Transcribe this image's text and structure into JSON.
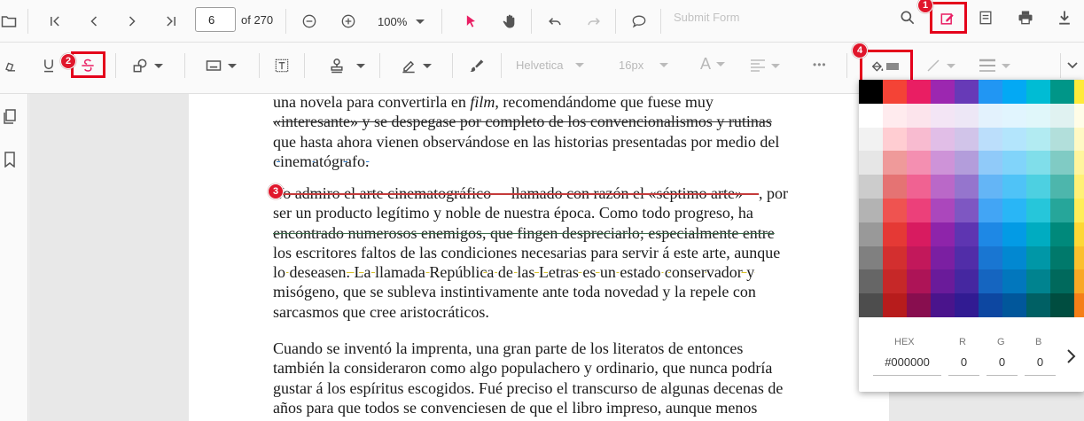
{
  "main_toolbar": {
    "page_number": "6",
    "page_total": "of 270",
    "zoom": "100%",
    "submit_form": "Submit Form"
  },
  "annotation_toolbar": {
    "font_family": "Helvetica",
    "font_size": "16px",
    "font_color_glyph": "A",
    "more": "•••"
  },
  "callouts": [
    "1",
    "2",
    "3",
    "4"
  ],
  "document": {
    "paragraph1": [
      "una novela para convertirla en film, recomendándome que fuese muy",
      "«interesante» y se despegase por completo de los convencionalismos y rutinas",
      "que hasta ahora vienen observándose en las historias presentadas por medio del",
      "cinematógrafo."
    ],
    "paragraph2": [
      "Yo admiro el arte cinematográfico —llamado con razón el «séptimo arte»—, por",
      "ser un producto legítimo y noble de nuestra época. Como todo progreso, ha",
      "encontrado numerosos enemigos, que fingen despreciarlo; especialmente entre",
      "los escritores faltos de las condiciones necesarias para servir á este arte, aunque",
      "lo deseasen. La llamada República de las Letras es un estado conservador y",
      "misógeno, que se subleva instintivamente ante toda novedad y la repele con",
      "sarcasmos que cree aristocráticos."
    ],
    "paragraph3": [
      "Cuando se inventó la imprenta, una gran parte de los literatos de entonces",
      "también la consideraron como algo populachero y ordinario, que nunca podría",
      "gustar á los espíritus escogidos. Fué preciso el transcurso de algunas decenas de",
      "años para que todos se convenciesen de que el libro impreso, aunque menos"
    ]
  },
  "color_picker": {
    "labels": {
      "hex": "HEX",
      "r": "R",
      "g": "G",
      "b": "B"
    },
    "values": {
      "hex": "#000000",
      "r": "0",
      "g": "0",
      "b": "0"
    },
    "swatches": [
      [
        "#000000",
        "#f44336",
        "#e91e63",
        "#9c27b0",
        "#673ab7",
        "#2196f3",
        "#03a9f4",
        "#00bcd4",
        "#009688",
        "#ffeb3b"
      ],
      [
        "#ffffff",
        "#ffebee",
        "#fce4ec",
        "#f3e5f5",
        "#ede7f6",
        "#e3f2fd",
        "#e1f5fe",
        "#e0f7fa",
        "#e0f2f1",
        "#fffde7"
      ],
      [
        "#f2f2f2",
        "#ffcdd2",
        "#f8bbd0",
        "#e1bee7",
        "#d1c4e9",
        "#bbdefb",
        "#b3e5fc",
        "#b2ebf2",
        "#b2dfdb",
        "#fff9c4"
      ],
      [
        "#e6e6e6",
        "#ef9a9a",
        "#f48fb1",
        "#ce93d8",
        "#b39ddb",
        "#90caf9",
        "#81d4fa",
        "#80deea",
        "#80cbc4",
        "#fff59d"
      ],
      [
        "#cccccc",
        "#e57373",
        "#f06292",
        "#ba68c8",
        "#9575cd",
        "#64b5f6",
        "#4fc3f7",
        "#4dd0e1",
        "#4db6ac",
        "#fff176"
      ],
      [
        "#b3b3b3",
        "#ef5350",
        "#ec407a",
        "#ab47bc",
        "#7e57c2",
        "#42a5f5",
        "#29b6f6",
        "#26c6da",
        "#26a69a",
        "#ffee58"
      ],
      [
        "#999999",
        "#e53935",
        "#d81b60",
        "#8e24aa",
        "#5e35b1",
        "#1e88e5",
        "#039be5",
        "#00acc1",
        "#00897b",
        "#fdd835"
      ],
      [
        "#808080",
        "#d32f2f",
        "#c2185b",
        "#7b1fa2",
        "#512da8",
        "#1976d2",
        "#0288d1",
        "#0097a7",
        "#00796b",
        "#fbc02d"
      ],
      [
        "#666666",
        "#c62828",
        "#ad1457",
        "#6a1b9a",
        "#4527a0",
        "#1565c0",
        "#0277bd",
        "#00838f",
        "#00695c",
        "#f9a825"
      ],
      [
        "#4d4d4d",
        "#b71c1c",
        "#880e4f",
        "#4a148c",
        "#311b92",
        "#0d47a1",
        "#01579b",
        "#006064",
        "#004d40",
        "#f57f17"
      ]
    ]
  },
  "colors": {
    "accent_red": "#e4001b",
    "toolbar_bg": "#fafafa",
    "annotation_cursor": "#e91e63"
  }
}
